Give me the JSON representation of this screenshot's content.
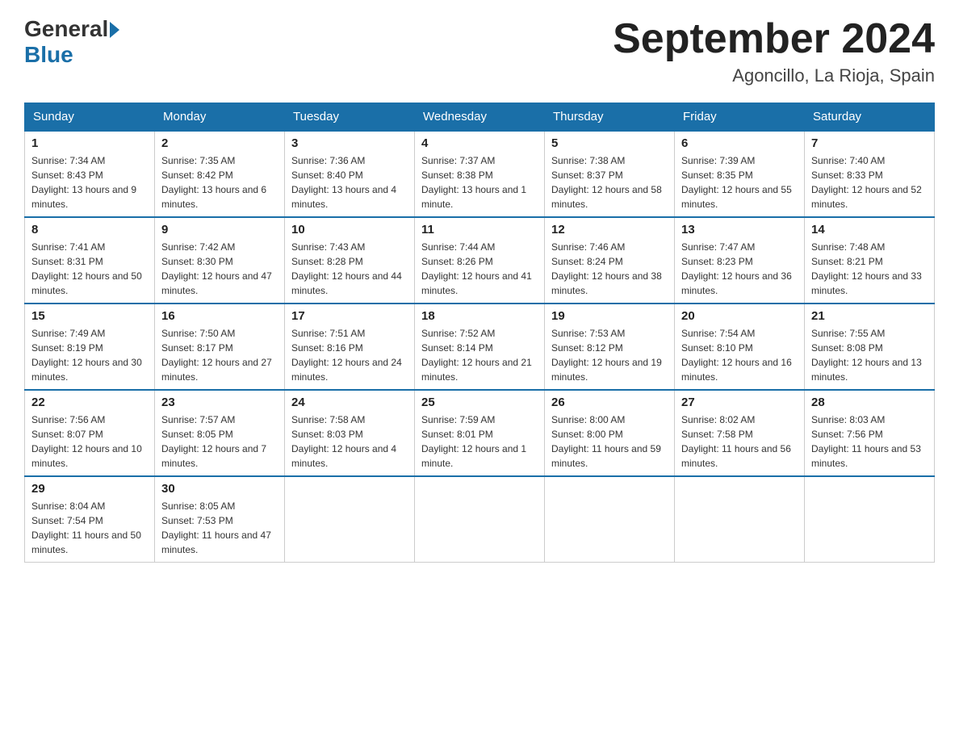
{
  "logo": {
    "general": "General",
    "blue": "Blue"
  },
  "title": "September 2024",
  "location": "Agoncillo, La Rioja, Spain",
  "days_of_week": [
    "Sunday",
    "Monday",
    "Tuesday",
    "Wednesday",
    "Thursday",
    "Friday",
    "Saturday"
  ],
  "weeks": [
    [
      {
        "day": "1",
        "sunrise": "7:34 AM",
        "sunset": "8:43 PM",
        "daylight": "13 hours and 9 minutes."
      },
      {
        "day": "2",
        "sunrise": "7:35 AM",
        "sunset": "8:42 PM",
        "daylight": "13 hours and 6 minutes."
      },
      {
        "day": "3",
        "sunrise": "7:36 AM",
        "sunset": "8:40 PM",
        "daylight": "13 hours and 4 minutes."
      },
      {
        "day": "4",
        "sunrise": "7:37 AM",
        "sunset": "8:38 PM",
        "daylight": "13 hours and 1 minute."
      },
      {
        "day": "5",
        "sunrise": "7:38 AM",
        "sunset": "8:37 PM",
        "daylight": "12 hours and 58 minutes."
      },
      {
        "day": "6",
        "sunrise": "7:39 AM",
        "sunset": "8:35 PM",
        "daylight": "12 hours and 55 minutes."
      },
      {
        "day": "7",
        "sunrise": "7:40 AM",
        "sunset": "8:33 PM",
        "daylight": "12 hours and 52 minutes."
      }
    ],
    [
      {
        "day": "8",
        "sunrise": "7:41 AM",
        "sunset": "8:31 PM",
        "daylight": "12 hours and 50 minutes."
      },
      {
        "day": "9",
        "sunrise": "7:42 AM",
        "sunset": "8:30 PM",
        "daylight": "12 hours and 47 minutes."
      },
      {
        "day": "10",
        "sunrise": "7:43 AM",
        "sunset": "8:28 PM",
        "daylight": "12 hours and 44 minutes."
      },
      {
        "day": "11",
        "sunrise": "7:44 AM",
        "sunset": "8:26 PM",
        "daylight": "12 hours and 41 minutes."
      },
      {
        "day": "12",
        "sunrise": "7:46 AM",
        "sunset": "8:24 PM",
        "daylight": "12 hours and 38 minutes."
      },
      {
        "day": "13",
        "sunrise": "7:47 AM",
        "sunset": "8:23 PM",
        "daylight": "12 hours and 36 minutes."
      },
      {
        "day": "14",
        "sunrise": "7:48 AM",
        "sunset": "8:21 PM",
        "daylight": "12 hours and 33 minutes."
      }
    ],
    [
      {
        "day": "15",
        "sunrise": "7:49 AM",
        "sunset": "8:19 PM",
        "daylight": "12 hours and 30 minutes."
      },
      {
        "day": "16",
        "sunrise": "7:50 AM",
        "sunset": "8:17 PM",
        "daylight": "12 hours and 27 minutes."
      },
      {
        "day": "17",
        "sunrise": "7:51 AM",
        "sunset": "8:16 PM",
        "daylight": "12 hours and 24 minutes."
      },
      {
        "day": "18",
        "sunrise": "7:52 AM",
        "sunset": "8:14 PM",
        "daylight": "12 hours and 21 minutes."
      },
      {
        "day": "19",
        "sunrise": "7:53 AM",
        "sunset": "8:12 PM",
        "daylight": "12 hours and 19 minutes."
      },
      {
        "day": "20",
        "sunrise": "7:54 AM",
        "sunset": "8:10 PM",
        "daylight": "12 hours and 16 minutes."
      },
      {
        "day": "21",
        "sunrise": "7:55 AM",
        "sunset": "8:08 PM",
        "daylight": "12 hours and 13 minutes."
      }
    ],
    [
      {
        "day": "22",
        "sunrise": "7:56 AM",
        "sunset": "8:07 PM",
        "daylight": "12 hours and 10 minutes."
      },
      {
        "day": "23",
        "sunrise": "7:57 AM",
        "sunset": "8:05 PM",
        "daylight": "12 hours and 7 minutes."
      },
      {
        "day": "24",
        "sunrise": "7:58 AM",
        "sunset": "8:03 PM",
        "daylight": "12 hours and 4 minutes."
      },
      {
        "day": "25",
        "sunrise": "7:59 AM",
        "sunset": "8:01 PM",
        "daylight": "12 hours and 1 minute."
      },
      {
        "day": "26",
        "sunrise": "8:00 AM",
        "sunset": "8:00 PM",
        "daylight": "11 hours and 59 minutes."
      },
      {
        "day": "27",
        "sunrise": "8:02 AM",
        "sunset": "7:58 PM",
        "daylight": "11 hours and 56 minutes."
      },
      {
        "day": "28",
        "sunrise": "8:03 AM",
        "sunset": "7:56 PM",
        "daylight": "11 hours and 53 minutes."
      }
    ],
    [
      {
        "day": "29",
        "sunrise": "8:04 AM",
        "sunset": "7:54 PM",
        "daylight": "11 hours and 50 minutes."
      },
      {
        "day": "30",
        "sunrise": "8:05 AM",
        "sunset": "7:53 PM",
        "daylight": "11 hours and 47 minutes."
      },
      null,
      null,
      null,
      null,
      null
    ]
  ],
  "labels": {
    "sunrise": "Sunrise:",
    "sunset": "Sunset:",
    "daylight": "Daylight:"
  }
}
